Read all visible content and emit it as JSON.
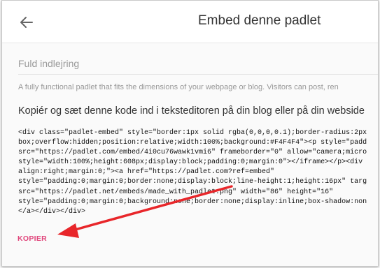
{
  "header": {
    "back_icon": "arrow-left-icon",
    "title": "Embed denne padlet"
  },
  "section": {
    "label": "Fuld indlejring",
    "description": "A fully functional padlet that fits the dimensions of your webpage or blog. Visitors can post, ren",
    "instruction": "Kopiér og sæt denne kode ind i teksteditoren på din blog eller på din webside"
  },
  "code_lines": [
    "<div class=\"padlet-embed\" style=\"border:1px solid rgba(0,0,0,0.1);border-radius:2px",
    "box;overflow:hidden;position:relative;width:100%;background:#F4F4F4\"><p style=\"padd",
    "src=\"https://padlet.com/embed/4i0cu76wawk1vmi6\" frameborder=\"0\" allow=\"camera;micro",
    "style=\"width:100%;height:608px;display:block;padding:0;margin:0\"></iframe></p><div",
    "align:right;margin:0;\"><a href=\"https://padlet.com?ref=embed\"",
    "style=\"padding:0;margin:0;border:none;display:block;line-height:1;height:16px\" targ",
    "src=\"https://padlet.net/embeds/made_with_padlet.png\" width=\"86\" height=\"16\"",
    "style=\"padding:0;margin:0;background:none;border:none;display:inline;box-shadow:non",
    "</a></div></div>"
  ],
  "copy_button": {
    "label": "KOPIER"
  },
  "colors": {
    "accent": "#e0457b",
    "annotation_arrow": "#e8262a"
  }
}
